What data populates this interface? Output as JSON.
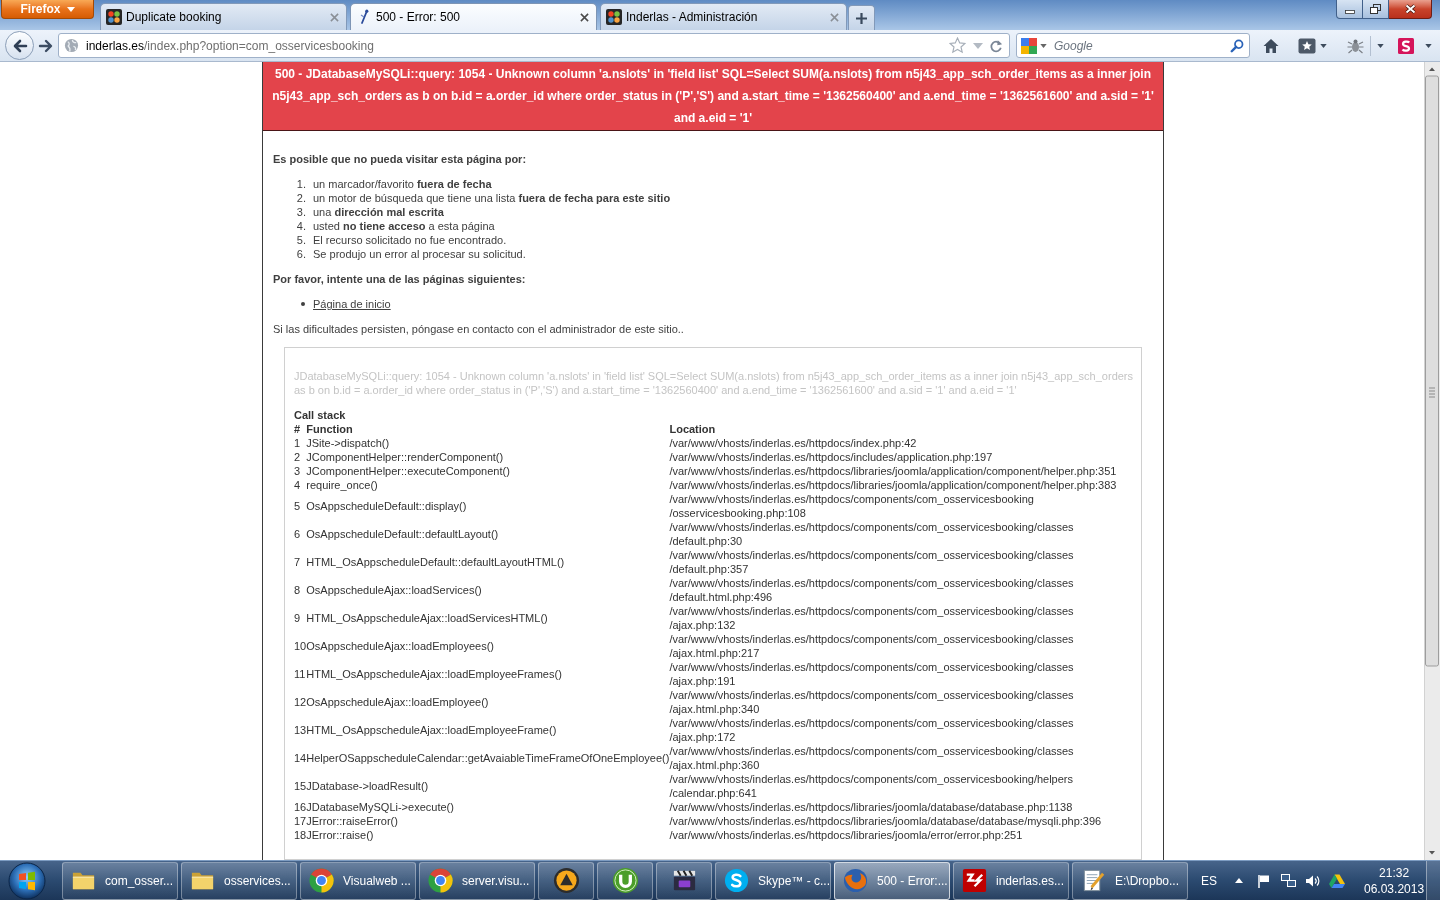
{
  "browser": {
    "menu_button": "Firefox",
    "tabs": [
      {
        "title": "Duplicate booking",
        "kind": "joomla",
        "selected": false
      },
      {
        "title": "500 - Error: 500",
        "kind": "error",
        "selected": true
      },
      {
        "title": "Inderlas - Administración",
        "kind": "joomla",
        "selected": false
      }
    ],
    "address": {
      "host": "inderlas.es",
      "path": "/index.php?option=com_osservicesbooking"
    },
    "search": {
      "placeholder": "Google"
    }
  },
  "page": {
    "error_banner": "500 - JDatabaseMySQLi::query: 1054 - Unknown column 'a.nslots' in 'field list' SQL=Select SUM(a.nslots) from n5j43_app_sch_order_items as a inner join n5j43_app_sch_orders as b on b.id = a.order_id where order_status in ('P','S') and a.start_time = '1362560400' and a.end_time = '1362561600' and a.sid = '1' and a.eid = '1'",
    "intro": "Es posible que no pueda visitar esta página por:",
    "reasons": [
      {
        "number": "1.",
        "text": "un marcador/favorito **fuera de fecha**"
      },
      {
        "number": "2.",
        "text": "un motor de búsqueda que tiene una lista **fuera de fecha para este sitio**"
      },
      {
        "number": "3.",
        "text": "una **dirección mal escrita**"
      },
      {
        "number": "4.",
        "text": "usted **no tiene acceso** a esta página"
      },
      {
        "number": "5.",
        "text": "El recurso solicitado no fue encontrado."
      },
      {
        "number": "6.",
        "text": "Se produjo un error al procesar su solicitud."
      }
    ],
    "suggestion_heading": "Por favor, intente una de las páginas siguientes:",
    "links": [
      "Página de inicio"
    ],
    "contact_note": "Si las dificultades persisten, póngase en contacto con el administrador de este sitio..",
    "debug": {
      "message": "JDatabaseMySQLi::query: 1054 - Unknown column 'a.nslots' in 'field list' SQL=Select SUM(a.nslots) from n5j43_app_sch_order_items as a inner join n5j43_app_sch_orders as b on b.id = a.order_id where order_status in ('P','S') and a.start_time = '1362560400' and a.end_time = '1362561600' and a.sid = '1' and a.eid = '1'",
      "title": "Call stack",
      "columns": [
        "#",
        "Function",
        "Location"
      ],
      "rows": [
        {
          "number": "1",
          "function": "JSite->dispatch()",
          "location": "/var/www/vhosts/inderlas.es/httpdocs/index.php:42"
        },
        {
          "number": "2",
          "function": "JComponentHelper::renderComponent()",
          "location": "/var/www/vhosts/inderlas.es/httpdocs/includes/application.php:197"
        },
        {
          "number": "3",
          "function": "JComponentHelper::executeComponent()",
          "location": "/var/www/vhosts/inderlas.es/httpdocs/libraries/joomla/application/component/helper.php:351"
        },
        {
          "number": "4",
          "function": "require_once()",
          "location": "/var/www/vhosts/inderlas.es/httpdocs/libraries/joomla/application/component/helper.php:383"
        },
        {
          "number": "5",
          "function": "OsAppscheduleDefault::display()",
          "location": "/var/www/vhosts/inderlas.es/httpdocs/components/com_osservicesbooking/osservicesbooking.php:108"
        },
        {
          "number": "6",
          "function": "OsAppscheduleDefault::defaultLayout()",
          "location": "/var/www/vhosts/inderlas.es/httpdocs/components/com_osservicesbooking/classes/default.php:30"
        },
        {
          "number": "7",
          "function": "HTML_OsAppscheduleDefault::defaultLayoutHTML()",
          "location": "/var/www/vhosts/inderlas.es/httpdocs/components/com_osservicesbooking/classes/default.php:357"
        },
        {
          "number": "8",
          "function": "OsAppscheduleAjax::loadServices()",
          "location": "/var/www/vhosts/inderlas.es/httpdocs/components/com_osservicesbooking/classes/default.html.php:496"
        },
        {
          "number": "9",
          "function": "HTML_OsAppscheduleAjax::loadServicesHTML()",
          "location": "/var/www/vhosts/inderlas.es/httpdocs/components/com_osservicesbooking/classes/ajax.php:132"
        },
        {
          "number": "10",
          "function": "OsAppscheduleAjax::loadEmployees()",
          "location": "/var/www/vhosts/inderlas.es/httpdocs/components/com_osservicesbooking/classes/ajax.html.php:217"
        },
        {
          "number": "11",
          "function": "HTML_OsAppscheduleAjax::loadEmployeeFrames()",
          "location": "/var/www/vhosts/inderlas.es/httpdocs/components/com_osservicesbooking/classes/ajax.php:191"
        },
        {
          "number": "12",
          "function": "OsAppscheduleAjax::loadEmployee()",
          "location": "/var/www/vhosts/inderlas.es/httpdocs/components/com_osservicesbooking/classes/ajax.html.php:340"
        },
        {
          "number": "13",
          "function": "HTML_OsAppscheduleAjax::loadEmployeeFrame()",
          "location": "/var/www/vhosts/inderlas.es/httpdocs/components/com_osservicesbooking/classes/ajax.php:172"
        },
        {
          "number": "14",
          "function": "HelperOSappscheduleCalendar::getAvaiableTimeFrameOfOneEmployee()",
          "location": "/var/www/vhosts/inderlas.es/httpdocs/components/com_osservicesbooking/classes/ajax.html.php:360"
        },
        {
          "number": "15",
          "function": "JDatabase->loadResult()",
          "location": "/var/www/vhosts/inderlas.es/httpdocs/components/com_osservicesbooking/helpers/calendar.php:641"
        },
        {
          "number": "16",
          "function": "JDatabaseMySQLi->execute()",
          "location": "/var/www/vhosts/inderlas.es/httpdocs/libraries/joomla/database/database.php:1138"
        },
        {
          "number": "17",
          "function": "JError::raiseError()",
          "location": "/var/www/vhosts/inderlas.es/httpdocs/libraries/joomla/database/database/mysqli.php:396"
        },
        {
          "number": "18",
          "function": "JError::raise()",
          "location": "/var/www/vhosts/inderlas.es/httpdocs/libraries/joomla/error/error.php:251"
        }
      ]
    }
  },
  "taskbar": {
    "items": [
      {
        "kind": "folder",
        "label": "com_osser...",
        "selected": false
      },
      {
        "kind": "folder",
        "label": "osservices...",
        "selected": false
      },
      {
        "kind": "chrome",
        "label": "Visualweb ...",
        "selected": false
      },
      {
        "kind": "chrome",
        "label": "server.visu...",
        "selected": false
      },
      {
        "kind": "aimp",
        "selected": false
      },
      {
        "kind": "utorrent",
        "selected": false
      },
      {
        "kind": "video",
        "selected": false
      },
      {
        "kind": "skype",
        "label": "Skype™ - c...",
        "selected": false
      },
      {
        "kind": "firefox",
        "label": "500 - Error:...",
        "selected": true
      },
      {
        "kind": "filezilla",
        "label": "inderlas.es...",
        "selected": false
      },
      {
        "kind": "notepad",
        "label": "E:\\Dropbo...",
        "selected": false
      }
    ],
    "tray": {
      "language": "ES",
      "time": "21:32",
      "date": "06.03.2013"
    }
  }
}
